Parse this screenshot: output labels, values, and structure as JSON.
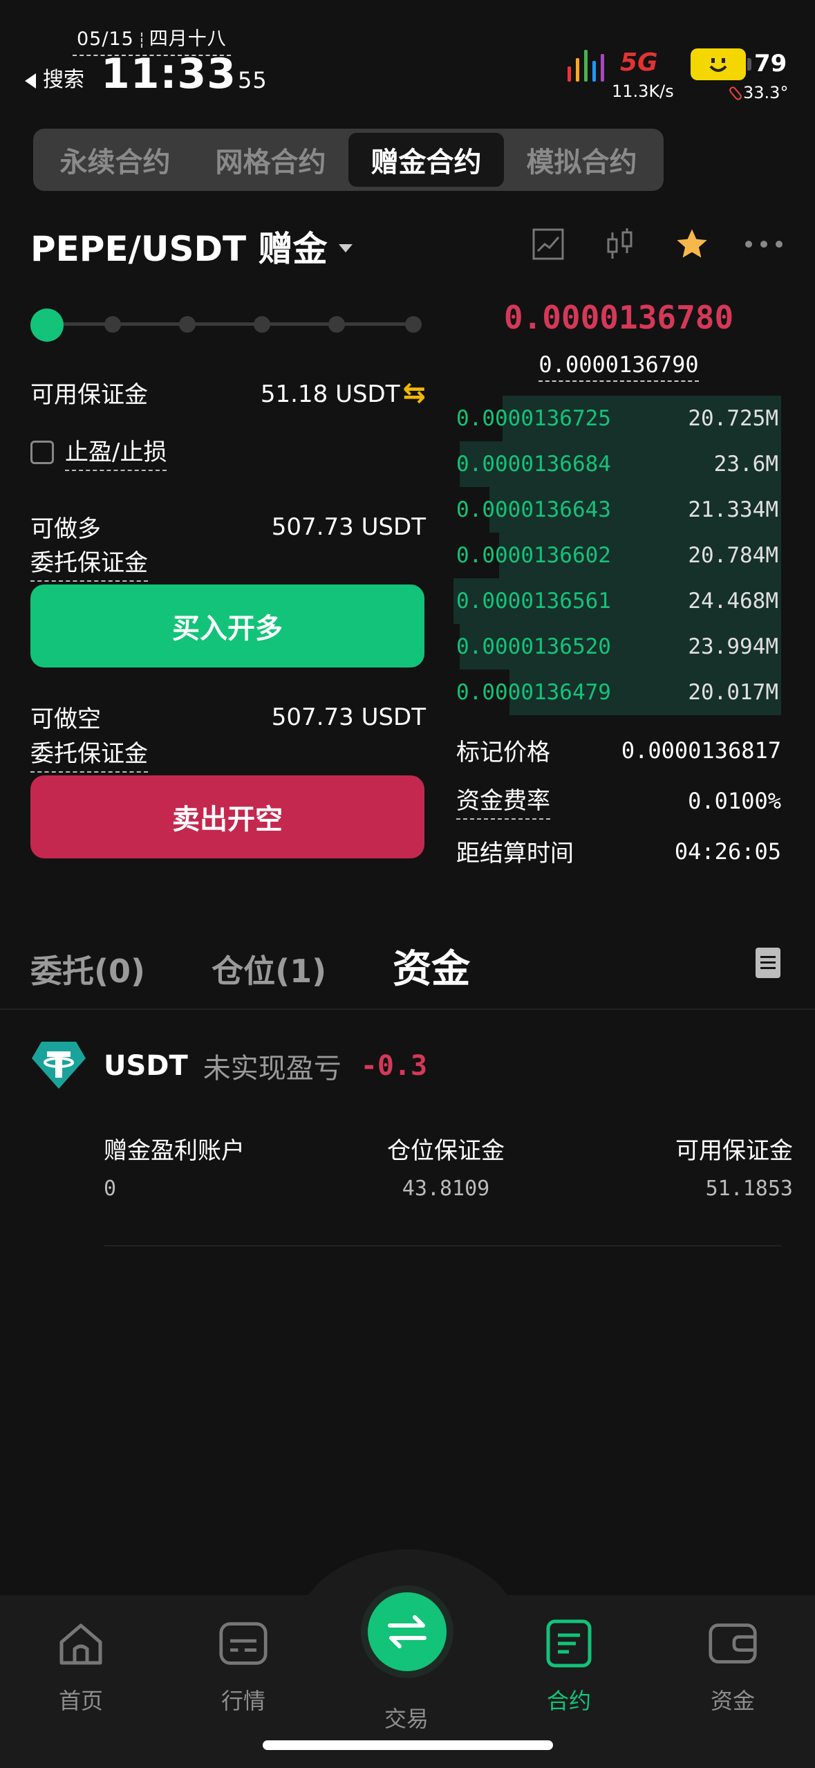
{
  "status_bar": {
    "date": "05/15",
    "lunar": "四月十八",
    "back_label": "搜索",
    "time": "11:33",
    "seconds": "55",
    "network": "5G",
    "speed": "11.3K/s",
    "battery": "79",
    "temperature": "33.3°"
  },
  "top_tabs": [
    "永续合约",
    "网格合约",
    "赠金合约",
    "模拟合约"
  ],
  "header": {
    "pair": "PEPE/USDT 赠金"
  },
  "leverage": {
    "steps": 6,
    "selected_index": 0
  },
  "left_panel": {
    "available_margin_label": "可用保证金",
    "available_margin_value": "51.18 USDT",
    "tp_sl_label": "止盈/止损",
    "long_label": "可做多",
    "long_value": "507.73 USDT",
    "long_order_margin_label": "委托保证金",
    "buy_button": "买入开多",
    "short_label": "可做空",
    "short_value": "507.73 USDT",
    "short_order_margin_label": "委托保证金",
    "sell_button": "卖出开空"
  },
  "order_book": {
    "last_price": "0.0000136780",
    "mark_price": "0.0000136790",
    "bids": [
      {
        "price": "0.0000136725",
        "qty": "20.725M",
        "depth": 0.85
      },
      {
        "price": "0.0000136684",
        "qty": "23.6M",
        "depth": 0.98
      },
      {
        "price": "0.0000136643",
        "qty": "21.334M",
        "depth": 0.89
      },
      {
        "price": "0.0000136602",
        "qty": "20.784M",
        "depth": 0.86
      },
      {
        "price": "0.0000136561",
        "qty": "24.468M",
        "depth": 1.0
      },
      {
        "price": "0.0000136520",
        "qty": "23.994M",
        "depth": 0.98
      },
      {
        "price": "0.0000136479",
        "qty": "20.017M",
        "depth": 0.83
      }
    ],
    "mark_price_label": "标记价格",
    "mark_price_value": "0.0000136817",
    "funding_rate_label": "资金费率",
    "funding_rate_value": "0.0100%",
    "settle_label": "距结算时间",
    "settle_value": "04:26:05"
  },
  "bottom_tabs": {
    "orders": "委托(0)",
    "positions": "仓位(1)",
    "funds": "资金"
  },
  "asset": {
    "name": "USDT",
    "unrealized_label": "未实现盈亏",
    "unrealized_value": "-0.3",
    "bonus_profit_label": "赠金盈利账户",
    "bonus_profit_value": "0",
    "position_margin_label": "仓位保证金",
    "position_margin_value": "43.8109",
    "available_margin_label": "可用保证金",
    "available_margin_value": "51.1853"
  },
  "nav": [
    "首页",
    "行情",
    "交易",
    "合约",
    "资金"
  ],
  "colors": {
    "accent_green": "#12c379",
    "sell_red": "#c4284f",
    "price_red": "#d63858",
    "swap_yellow": "#f2b705"
  }
}
